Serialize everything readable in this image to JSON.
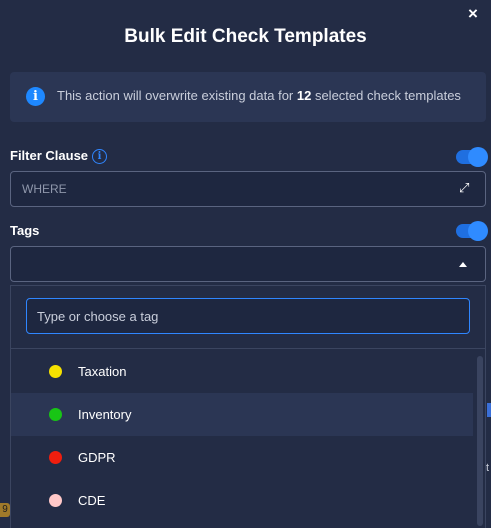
{
  "modal": {
    "title": "Bulk Edit Check Templates",
    "close_glyph": "×",
    "banner": {
      "icon": "info-icon",
      "text_before": "This action will overwrite existing data for ",
      "count": "12",
      "text_after": " selected check templates"
    }
  },
  "filter_clause": {
    "label": "Filter Clause",
    "toggle_on": true,
    "placeholder": "WHERE",
    "expand_glyph": "⤢"
  },
  "tags": {
    "label": "Tags",
    "toggle_on": true,
    "search_placeholder": "Type or choose a tag",
    "options": [
      {
        "label": "Taxation",
        "color": "#f5e100"
      },
      {
        "label": "Inventory",
        "color": "#18c515"
      },
      {
        "label": "GDPR",
        "color": "#f01e0e"
      },
      {
        "label": "CDE",
        "color": "#ffc8c8"
      }
    ]
  },
  "background": {
    "badge": "9",
    "edge_text": "t"
  },
  "colors": {
    "accent": "#2f86ff",
    "panel": "#232c45"
  }
}
